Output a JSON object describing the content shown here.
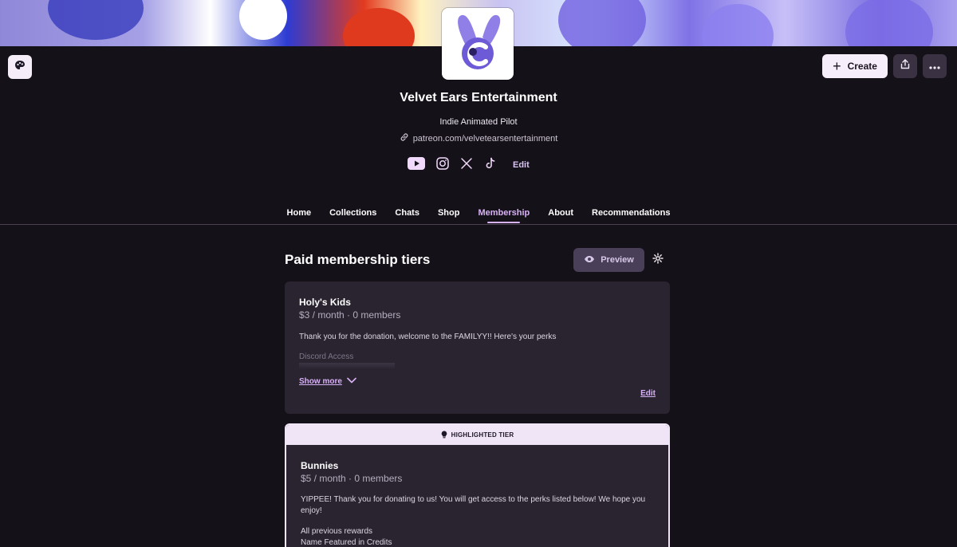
{
  "header": {
    "creator_name": "Velvet Ears Entertainment",
    "tagline": "Indie Animated Pilot",
    "url": "patreon.com/velvetearsentertainment",
    "social_edit_label": "Edit",
    "create_label": "Create",
    "icons": {
      "corner": "palette-icon",
      "plus": "plus-icon",
      "share": "share-icon",
      "more": "more-icon",
      "link": "link-icon",
      "socials": [
        "youtube-icon",
        "instagram-icon",
        "x-icon",
        "tiktok-icon"
      ]
    }
  },
  "nav": {
    "tabs": [
      {
        "label": "Home"
      },
      {
        "label": "Collections"
      },
      {
        "label": "Chats"
      },
      {
        "label": "Shop"
      },
      {
        "label": "Membership",
        "active": true
      },
      {
        "label": "About"
      },
      {
        "label": "Recommendations"
      }
    ]
  },
  "membership": {
    "title": "Paid membership tiers",
    "preview_label": "Preview",
    "tiers": [
      {
        "name": "Holy's Kids",
        "price": "$3 / month · 0 members",
        "description": "Thank you for the donation, welcome to the FAMILYY!! Here's your perks",
        "perk_preview": "Discord Access",
        "show_more_label": "Show more",
        "edit_label": "Edit"
      },
      {
        "highlight_label": "HIGHLIGHTED TIER",
        "name": "Bunnies",
        "price": "$5 / month · 0 members",
        "description": "YIPPEE! Thank you for donating to us! You will get access to the perks listed below! We hope you enjoy!",
        "perks": [
          "All previous rewards",
          "Name Featured in Credits"
        ]
      }
    ]
  },
  "colors": {
    "background": "#151119",
    "accent": "#d7b2f5",
    "card": "#2a2431",
    "highlight": "#f0e4f7"
  }
}
